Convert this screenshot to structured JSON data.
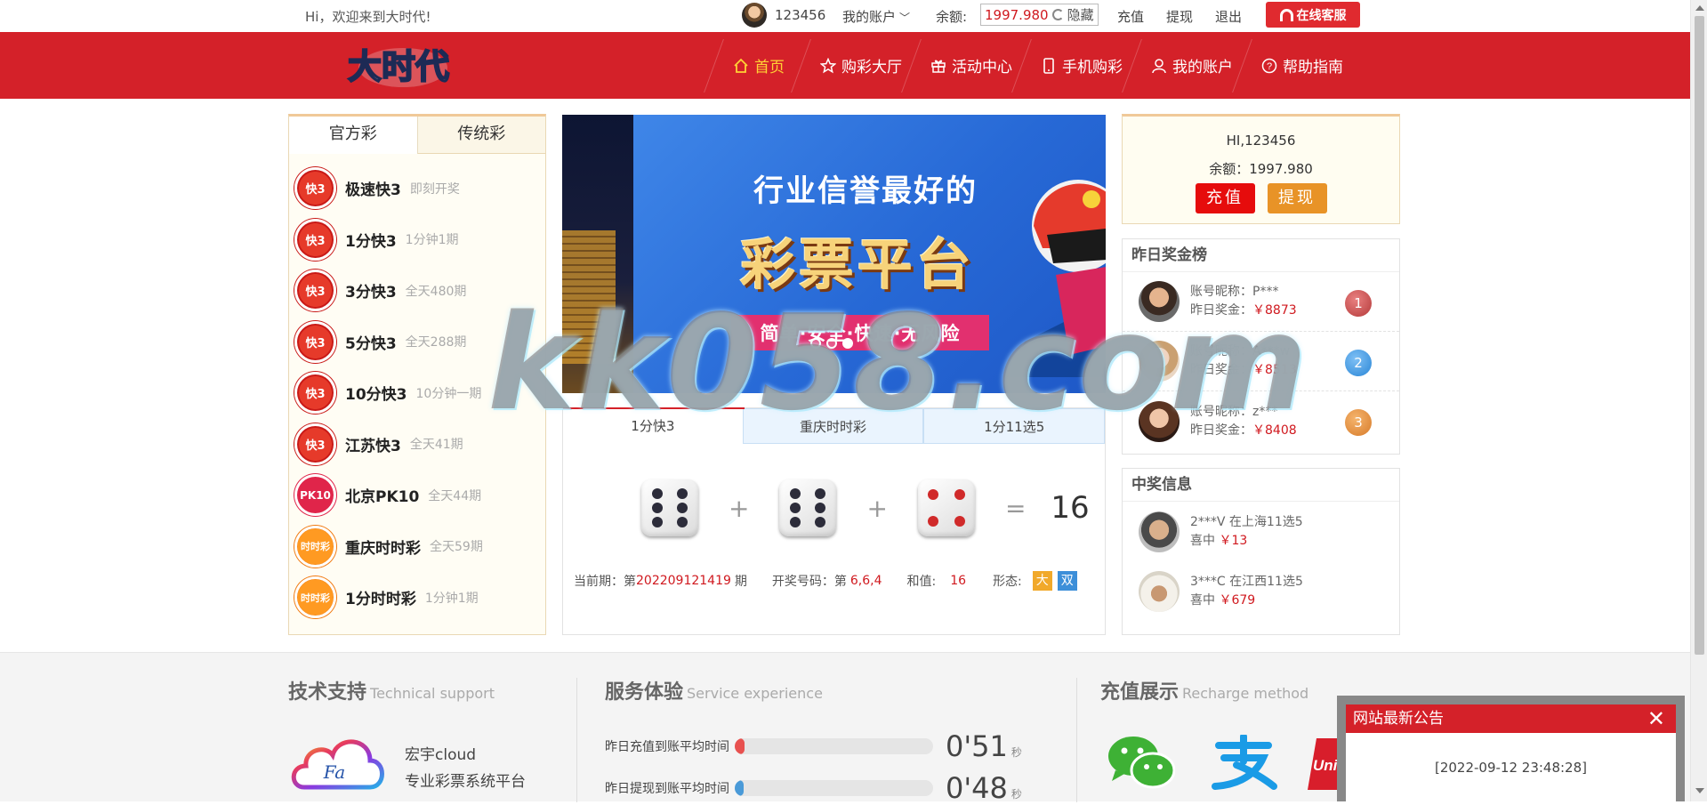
{
  "topbar": {
    "welcome": "Hi，欢迎来到大时代!",
    "username": "123456",
    "account_menu": "我的账户",
    "balance_label": "余额:",
    "balance_value": "1997.980",
    "hide_label": "隐藏",
    "recharge": "充值",
    "withdraw": "提现",
    "logout": "退出",
    "service": "在线客服"
  },
  "nav": {
    "logo_text": "大时代",
    "items": [
      {
        "label": "首页",
        "icon": "home-icon"
      },
      {
        "label": "购彩大厅",
        "icon": "star-icon"
      },
      {
        "label": "活动中心",
        "icon": "gift-icon"
      },
      {
        "label": "手机购彩",
        "icon": "phone-icon"
      },
      {
        "label": "我的账户",
        "icon": "user-icon"
      },
      {
        "label": "帮助指南",
        "icon": "help-icon"
      }
    ]
  },
  "lottery_panel": {
    "tabs": [
      "官方彩",
      "传统彩"
    ],
    "games": [
      {
        "name": "极速快3",
        "desc": "即刻开奖",
        "icon": "快3"
      },
      {
        "name": "1分快3",
        "desc": "1分钟1期",
        "icon": "快3"
      },
      {
        "name": "3分快3",
        "desc": "全天480期",
        "icon": "快3"
      },
      {
        "name": "5分快3",
        "desc": "全天288期",
        "icon": "快3"
      },
      {
        "name": "10分快3",
        "desc": "10分钟一期",
        "icon": "快3"
      },
      {
        "name": "江苏快3",
        "desc": "全天41期",
        "icon": "快3"
      },
      {
        "name": "北京PK10",
        "desc": "全天44期",
        "icon": "PK10"
      },
      {
        "name": "重庆时时彩",
        "desc": "全天59期",
        "icon": "时时彩"
      },
      {
        "name": "1分时时彩",
        "desc": "1分钟1期",
        "icon": "时时彩"
      }
    ]
  },
  "banner": {
    "line1": "行业信誉最好的",
    "line2": "彩票平台",
    "ribbon": "简单·安全·快速·无风险"
  },
  "result": {
    "tabs": [
      "1分快3",
      "重庆时时彩",
      "1分11选5"
    ],
    "dice": [
      6,
      6,
      4
    ],
    "sum": "16",
    "plus": "+",
    "equals": "=",
    "current_label": "当前期：第",
    "issue": "202209121419",
    "issue_suffix": "期",
    "numbers_label": "开奖号码：第",
    "numbers": "6,6,4",
    "sum_label": "和值:",
    "sum_value": "16",
    "form_label": "形态:",
    "form_big": "大",
    "form_even": "双"
  },
  "userbox": {
    "hi": "HI,123456",
    "balance": "余额：1997.980",
    "recharge": "充值",
    "withdraw": "提现"
  },
  "ranking": {
    "title": "昨日奖金榜",
    "nick_label": "账号昵称：",
    "amount_label": "昨日奖金：",
    "rows": [
      {
        "nick": "P***",
        "amount": "￥8873",
        "rank": "1"
      },
      {
        "nick": "A***w",
        "amount": "￥8513",
        "rank": "2"
      },
      {
        "nick": "z***",
        "amount": "￥8408",
        "rank": "3"
      }
    ]
  },
  "winners": {
    "title": "中奖信息",
    "won_label": "喜中",
    "rows": [
      {
        "who": "2***V 在上海11选5",
        "amount": "￥13"
      },
      {
        "who": "3***C 在江西11选5",
        "amount": "￥679"
      }
    ]
  },
  "footer": {
    "tech_title": "技术支持",
    "tech_en": "Technical support",
    "cloud_logo": "Fa",
    "cloud_name": "宏宇cloud",
    "cloud_desc": "专业彩票系统平台",
    "service_title": "服务体验",
    "service_en": "Service experience",
    "speed": [
      {
        "label": "昨日充值到账平均时间",
        "value": "0'51",
        "unit": "秒",
        "fill": 0.05,
        "color": "#e8514f"
      },
      {
        "label": "昨日提现到账平均时间",
        "value": "0'48",
        "unit": "秒",
        "fill": 0.04,
        "color": "#4a9ad8"
      }
    ],
    "recharge_title": "充值展示",
    "recharge_en": "Recharge method",
    "pay_icons": [
      "wechat-icon",
      "alipay-icon",
      "unionpay-icon"
    ],
    "unionpay_text": "Uni"
  },
  "notice": {
    "title": "网站最新公告",
    "close": "✕",
    "time": "[2022-09-12 23:48:28]"
  },
  "watermark": "kk058.com"
}
